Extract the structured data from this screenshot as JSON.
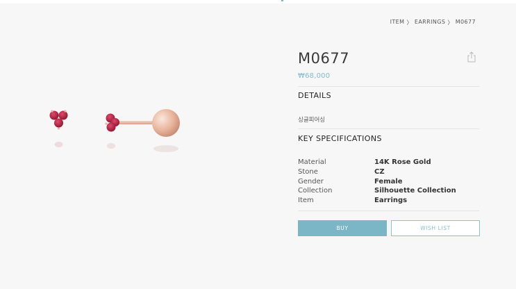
{
  "breadcrumb": {
    "items": [
      "ITEM",
      "EARRINGS",
      "M0677"
    ],
    "separator": "〉"
  },
  "product": {
    "name": "M0677",
    "price": "₩68,000",
    "details_heading": "DETAILS",
    "description": "싱글피어싱",
    "specs_heading": "KEY SPECIFICATIONS",
    "specs": [
      {
        "label": "Material",
        "value": "14K Rose Gold"
      },
      {
        "label": "Stone",
        "value": "CZ"
      },
      {
        "label": "Gender",
        "value": "Female"
      },
      {
        "label": "Collection",
        "value": "Silhouette Collection"
      },
      {
        "label": "Item",
        "value": "Earrings"
      }
    ]
  },
  "actions": {
    "buy_label": "BUY",
    "wishlist_label": "WISH LIST"
  },
  "icons": {
    "share": "share-icon"
  },
  "colors": {
    "accent": "#7ab6c5",
    "stone": "#b0203f",
    "gold": "#e8b8a0"
  }
}
